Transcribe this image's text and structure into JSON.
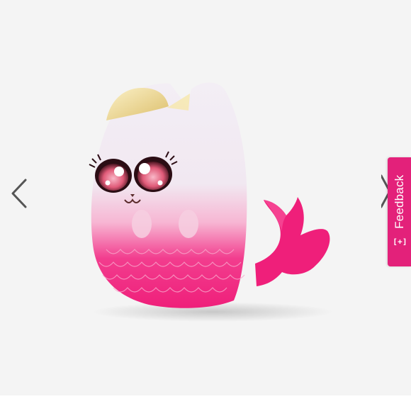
{
  "viewer": {
    "image_subject": "pink-white-cat-mermaid-squishy",
    "background_color": "#f4f4f4"
  },
  "navigation": {
    "prev_icon": "chevron-left-icon",
    "next_icon": "chevron-right-icon"
  },
  "feedback": {
    "label": "Feedback",
    "icon_text": "[+]",
    "color": "#e3217a"
  }
}
